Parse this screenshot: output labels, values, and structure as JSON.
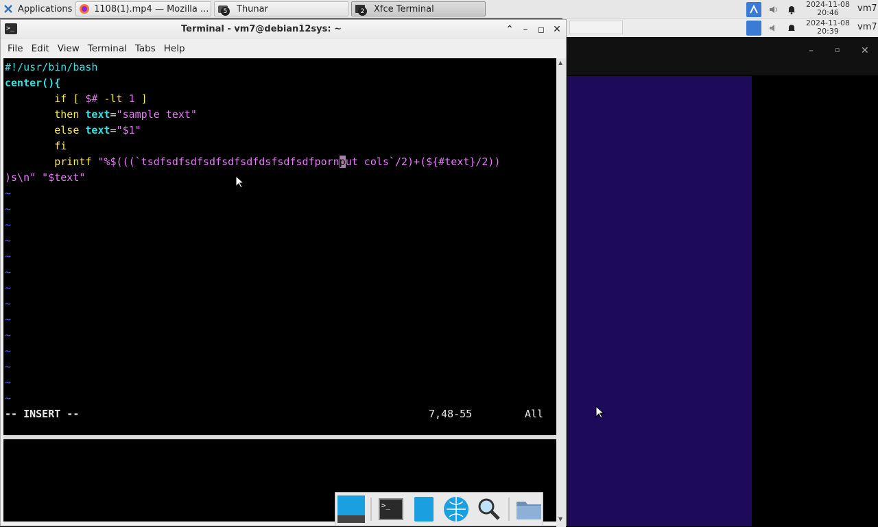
{
  "panel": {
    "applications_label": "Applications",
    "tasks": [
      {
        "label": "1108(1).mp4 — Mozilla ...",
        "icon": "firefox-icon"
      },
      {
        "label": "Thunar",
        "icon": "thunar-icon",
        "badge": "5"
      },
      {
        "label": "Xfce Terminal",
        "icon": "terminal-icon",
        "badge": "2"
      }
    ],
    "clock_top": {
      "date": "2024-11-08",
      "time": "20:46"
    },
    "clock_back": {
      "date": "2024-11-08",
      "time": "20:39"
    },
    "user": "vm7"
  },
  "window": {
    "title": "Terminal - vm7@debian12sys: ~",
    "menus": [
      "File",
      "Edit",
      "View",
      "Terminal",
      "Tabs",
      "Help"
    ]
  },
  "editor": {
    "line1": "#!/usr/bin/bash",
    "line2_a": "center(){",
    "line3_a": "        if [ ",
    "line3_b": "$#",
    "line3_c": " -lt ",
    "line3_d": "1",
    "line3_e": " ]",
    "line4_a": "        then ",
    "line4_b": "text",
    "line4_c": "=",
    "line4_d": "\"sample text\"",
    "line5_a": "        else ",
    "line5_b": "text",
    "line5_c": "=",
    "line5_d": "\"$1\"",
    "line6": "        fi",
    "line7_a": "        printf ",
    "line7_b": "\"%$(((`tsdfsdfsdfsdfsdfsdfdsfsdfsdfporn",
    "line7_cursor": "p",
    "line7_c": "ut cols`/2)+(${#text}/2))",
    "line8_a": ")s\\n\"",
    "line8_b": " \"$text\"",
    "tilde": "~",
    "mode": "-- INSERT --",
    "position": "7,48-55",
    "scroll": "All"
  }
}
